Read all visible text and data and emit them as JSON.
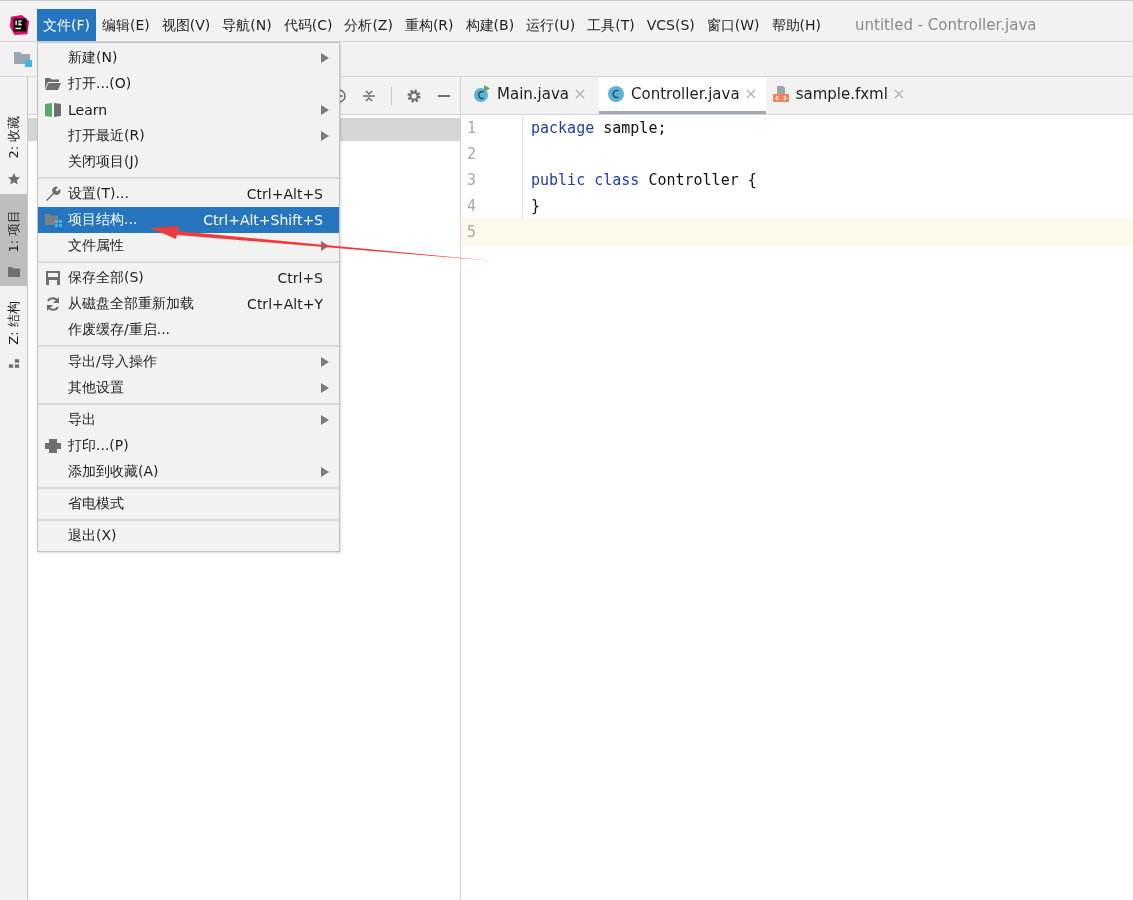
{
  "menubar": {
    "menus": [
      {
        "label": "文件(F)",
        "selected": true
      },
      {
        "label": "编辑(E)",
        "selected": false
      },
      {
        "label": "视图(V)",
        "selected": false
      },
      {
        "label": "导航(N)",
        "selected": false
      },
      {
        "label": "代码(C)",
        "selected": false
      },
      {
        "label": "分析(Z)",
        "selected": false
      },
      {
        "label": "重构(R)",
        "selected": false
      },
      {
        "label": "构建(B)",
        "selected": false
      },
      {
        "label": "运行(U)",
        "selected": false
      },
      {
        "label": "工具(T)",
        "selected": false
      },
      {
        "label": "VCS(S)",
        "selected": false
      },
      {
        "label": "窗口(W)",
        "selected": false
      },
      {
        "label": "帮助(H)",
        "selected": false
      }
    ],
    "title": "untitled - Controller.java"
  },
  "side_stripe": [
    {
      "label": "2: 收藏",
      "kind": "star",
      "selected": false
    },
    {
      "label": "1: 项目",
      "kind": "folder",
      "selected": true
    },
    {
      "label": "Z: 结构",
      "kind": "structure",
      "selected": false
    }
  ],
  "file_menu": {
    "sections": [
      [
        {
          "label": "新建(N)",
          "kind": "plain",
          "submenu": true,
          "selected": false
        },
        {
          "label": "打开...(O)",
          "kind": "folder",
          "submenu": false,
          "selected": false
        },
        {
          "label": "Learn",
          "kind": "book",
          "submenu": true,
          "selected": false
        },
        {
          "label": "打开最近(R)",
          "kind": "plain",
          "submenu": true,
          "selected": false
        },
        {
          "label": "关闭项目(J)",
          "kind": "plain",
          "submenu": false,
          "selected": false
        }
      ],
      [
        {
          "label": "设置(T)...",
          "kind": "wrench",
          "shortcut": "Ctrl+Alt+S",
          "submenu": false,
          "selected": false
        },
        {
          "label": "项目结构...",
          "kind": "structure",
          "shortcut": "Ctrl+Alt+Shift+S",
          "submenu": false,
          "selected": true
        },
        {
          "label": "文件属性",
          "kind": "plain",
          "submenu": true,
          "selected": false
        }
      ],
      [
        {
          "label": "保存全部(S)",
          "kind": "save",
          "shortcut": "Ctrl+S",
          "submenu": false,
          "selected": false
        },
        {
          "label": "从磁盘全部重新加载",
          "kind": "reload",
          "shortcut": "Ctrl+Alt+Y",
          "submenu": false,
          "selected": false
        },
        {
          "label": "作废缓存/重启...",
          "kind": "plain",
          "submenu": false,
          "selected": false
        }
      ],
      [
        {
          "label": "导出/导入操作",
          "kind": "plain",
          "submenu": true,
          "selected": false
        },
        {
          "label": "其他设置",
          "kind": "plain",
          "submenu": true,
          "selected": false
        }
      ],
      [
        {
          "label": "导出",
          "kind": "plain",
          "submenu": true,
          "selected": false
        },
        {
          "label": "打印...(P)",
          "kind": "print",
          "submenu": false,
          "selected": false
        },
        {
          "label": "添加到收藏(A)",
          "kind": "plain",
          "submenu": true,
          "selected": false
        }
      ],
      [
        {
          "label": "省电模式",
          "kind": "plain",
          "submenu": false,
          "selected": false
        }
      ],
      [
        {
          "label": "退出(X)",
          "kind": "plain",
          "submenu": false,
          "selected": false
        }
      ]
    ]
  },
  "editor": {
    "tabs": [
      {
        "label": "Main.java",
        "kind": "runnable",
        "selected": false
      },
      {
        "label": "Controller.java",
        "kind": "class",
        "selected": true
      },
      {
        "label": "sample.fxml",
        "kind": "fxml",
        "selected": false
      }
    ],
    "lines": [
      {
        "number": "1",
        "current": false,
        "tokens": [
          {
            "text": "package",
            "kind": "keyword"
          },
          {
            "text": " sample;",
            "kind": "plain"
          }
        ]
      },
      {
        "number": "2",
        "current": false
      },
      {
        "number": "3",
        "current": false,
        "tokens": [
          {
            "text": "public",
            "kind": "keyword"
          },
          {
            "text": " class",
            "kind": "keyword"
          },
          {
            "text": " Controller {",
            "kind": "plain"
          }
        ]
      },
      {
        "number": "4",
        "current": false,
        "tokens": [
          {
            "text": "}",
            "kind": "plain"
          }
        ]
      },
      {
        "number": "5",
        "current": true
      }
    ]
  }
}
